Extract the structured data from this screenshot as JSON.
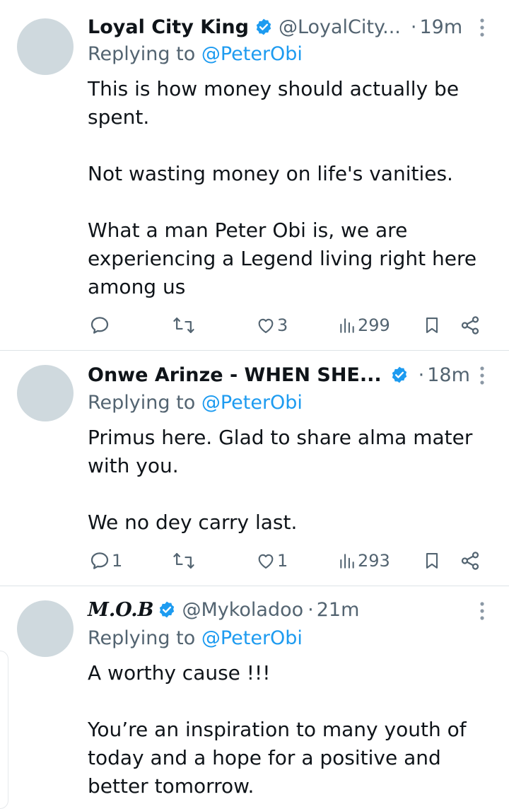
{
  "tweets": [
    {
      "name": "Loyal City King",
      "handle": "@LoyalCity...",
      "time": "19m",
      "dot": "·",
      "replying_prefix": "Replying to",
      "replying_to": "@PeterObi",
      "paragraphs": [
        "This is how money should actually be spent.",
        "",
        "Not wasting money on life's vanities.",
        "",
        "What a man Peter Obi is,  we are experiencing a Legend living right here among us"
      ],
      "replies": "",
      "likes": "3",
      "views": "299"
    },
    {
      "name": "Onwe Arinze - WHEN SHE...",
      "handle": "",
      "time": "18m",
      "dot": "·",
      "replying_prefix": "Replying to",
      "replying_to": "@PeterObi",
      "paragraphs": [
        "Primus here. Glad to share alma mater with you.",
        "",
        "We no dey carry last."
      ],
      "replies": "1",
      "likes": "1",
      "views": "293"
    },
    {
      "name": "M.O.B",
      "handle": "@Mykoladoo",
      "time": "21m",
      "dot": "·",
      "replying_prefix": "Replying to",
      "replying_to": "@PeterObi",
      "paragraphs": [
        "A worthy cause !!!",
        "",
        "You’re an inspiration to many youth of today and a hope for a positive and better tomorrow."
      ]
    }
  ],
  "colors": {
    "accent": "#1d9bf0",
    "secondary_text": "#536471",
    "primary_text": "#0f1419",
    "avatar_placeholder": "#cfd9de",
    "divider": "#dde3e7"
  },
  "icons": [
    "verified-badge-icon",
    "more-options-icon",
    "reply-icon",
    "retweet-icon",
    "like-icon",
    "views-icon",
    "bookmark-icon",
    "share-icon"
  ]
}
